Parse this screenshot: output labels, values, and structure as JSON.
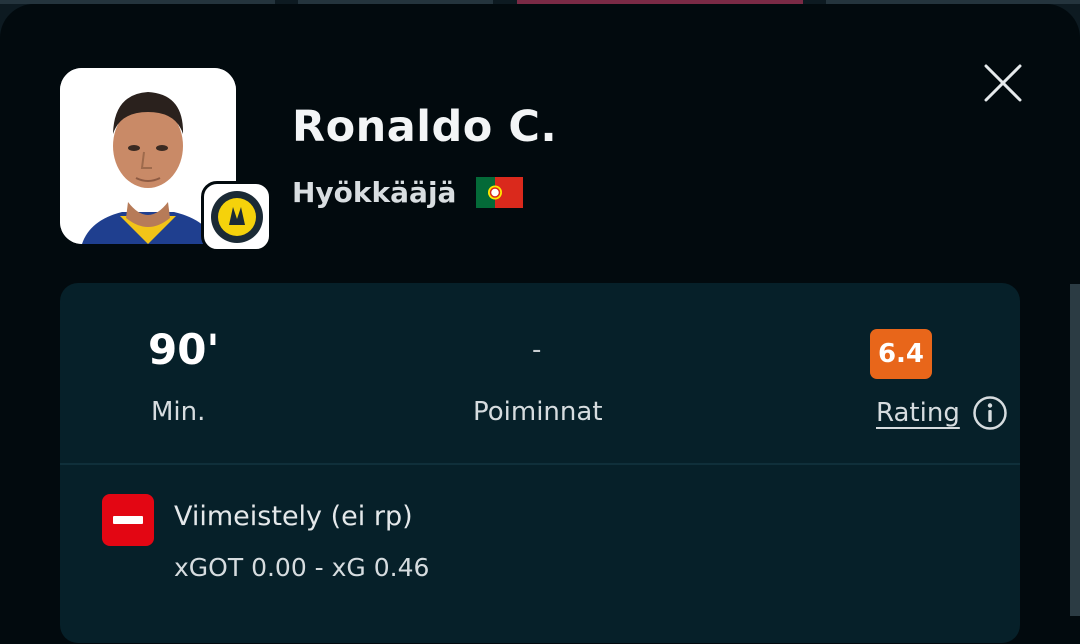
{
  "player": {
    "name": "Ronaldo C.",
    "position": "Hyökkääjä",
    "nationality_flag": "portugal-flag",
    "club_badge": "club-crest-icon"
  },
  "stats": {
    "minutes_value": "90'",
    "minutes_label": "Min.",
    "picks_value": "-",
    "picks_label": "Poiminnat",
    "rating_value": "6.4",
    "rating_label": "Rating",
    "rating_color": "#e8661a"
  },
  "event": {
    "title": "Viimeistely (ei rp)",
    "detail": "xGOT 0.00 - xG 0.46",
    "icon": "missed-shot-icon",
    "icon_color": "#e30613"
  },
  "colors": {
    "sheet_background": "#020a0e",
    "card_background": "#062029"
  }
}
